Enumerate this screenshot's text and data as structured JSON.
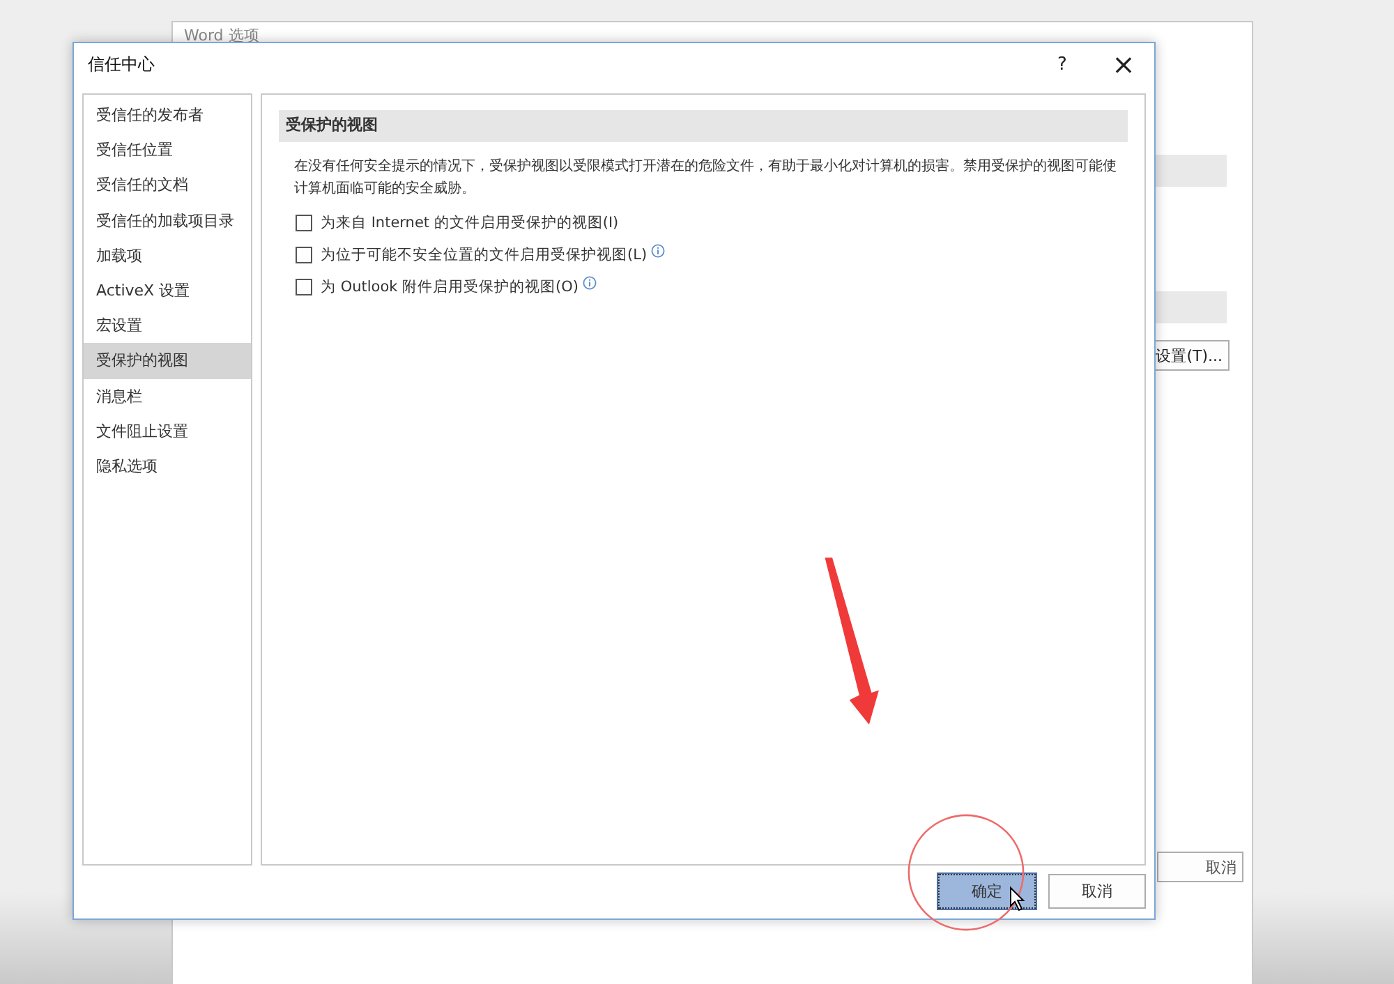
{
  "background_window": {
    "title": "Word 选项",
    "settings_button": "设置(T)...",
    "cancel_button": "取消"
  },
  "dialog": {
    "title": "信任中心",
    "help": "?",
    "close": "×"
  },
  "sidebar": {
    "items": [
      {
        "label": "受信任的发布者",
        "selected": false
      },
      {
        "label": "受信任位置",
        "selected": false
      },
      {
        "label": "受信任的文档",
        "selected": false
      },
      {
        "label": "受信任的加载项目录",
        "selected": false
      },
      {
        "label": "加载项",
        "selected": false
      },
      {
        "label": "ActiveX 设置",
        "selected": false
      },
      {
        "label": "宏设置",
        "selected": false
      },
      {
        "label": "受保护的视图",
        "selected": true
      },
      {
        "label": "消息栏",
        "selected": false
      },
      {
        "label": "文件阻止设置",
        "selected": false
      },
      {
        "label": "隐私选项",
        "selected": false
      }
    ]
  },
  "section": {
    "heading": "受保护的视图",
    "description": "在没有任何安全提示的情况下，受保护视图以受限模式打开潜在的危险文件，有助于最小化对计算机的损害。禁用受保护的视图可能使计算机面临可能的安全威胁。",
    "options": [
      {
        "label": "为来自 Internet 的文件启用受保护的视图(I)",
        "checked": false,
        "info": false
      },
      {
        "label": "为位于可能不安全位置的文件启用受保护视图(L)",
        "checked": false,
        "info": true
      },
      {
        "label": "为 Outlook 附件启用受保护的视图(O)",
        "checked": false,
        "info": true
      }
    ]
  },
  "buttons": [
    {
      "label": "确定",
      "selected": true
    },
    {
      "label": "取消",
      "selected": false
    }
  ]
}
